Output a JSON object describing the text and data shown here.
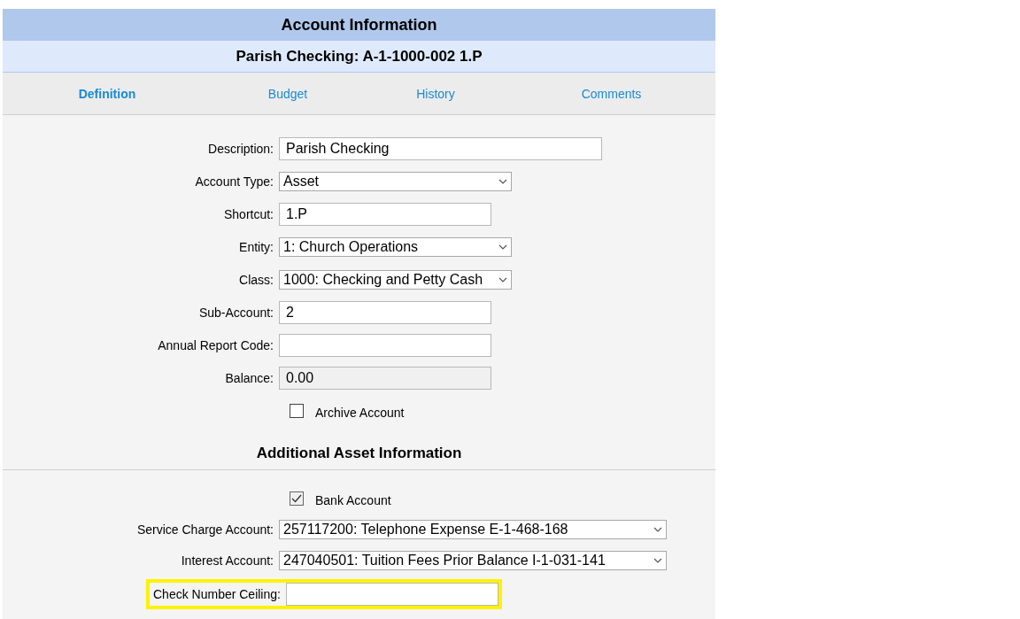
{
  "header": {
    "title": "Account Information",
    "subtitle": "Parish Checking: A-1-1000-002 1.P"
  },
  "tabs": [
    {
      "label": "Definition",
      "selected": true
    },
    {
      "label": "Budget",
      "selected": false
    },
    {
      "label": "History",
      "selected": false
    },
    {
      "label": "Comments",
      "selected": false
    }
  ],
  "fields": [
    {
      "kind": "text",
      "label": "Description:",
      "value": "Parish Checking",
      "readonly": false,
      "highlighted": false
    },
    {
      "kind": "select",
      "label": "Account Type:",
      "value": "Asset",
      "highlighted": false
    },
    {
      "kind": "text",
      "label": "Shortcut:",
      "value": "1.P",
      "readonly": false,
      "highlighted": false
    },
    {
      "kind": "select",
      "label": "Entity:",
      "value": "1: Church Operations",
      "highlighted": false
    },
    {
      "kind": "select",
      "label": "Class:",
      "value": "1000: Checking and Petty Cash",
      "highlighted": false
    },
    {
      "kind": "text",
      "label": "Sub-Account:",
      "value": "2",
      "readonly": false,
      "highlighted": false
    },
    {
      "kind": "text",
      "label": "Annual Report Code:",
      "readonly": false,
      "highlighted": false
    },
    {
      "kind": "text",
      "label": "Balance:",
      "value": "0.00",
      "readonly": true,
      "highlighted": false
    },
    {
      "kind": "checkbox",
      "label": "Archive Account",
      "checked": false,
      "highlighted": false
    }
  ],
  "section": {
    "title": "Additional Asset Information",
    "fields": [
      {
        "kind": "checkbox",
        "label": "Bank Account",
        "checked": true,
        "highlighted": false
      },
      {
        "kind": "select",
        "label": "Service Charge Account:",
        "value": "257117200: Telephone Expense E-1-468-168",
        "highlighted": false
      },
      {
        "kind": "select",
        "label": "Interest Account:",
        "value": "247040501: Tuition Fees Prior Balance I-1-031-141",
        "highlighted": false
      },
      {
        "kind": "text",
        "label": "Check Number Ceiling:",
        "readonly": false,
        "highlighted": true
      }
    ]
  }
}
